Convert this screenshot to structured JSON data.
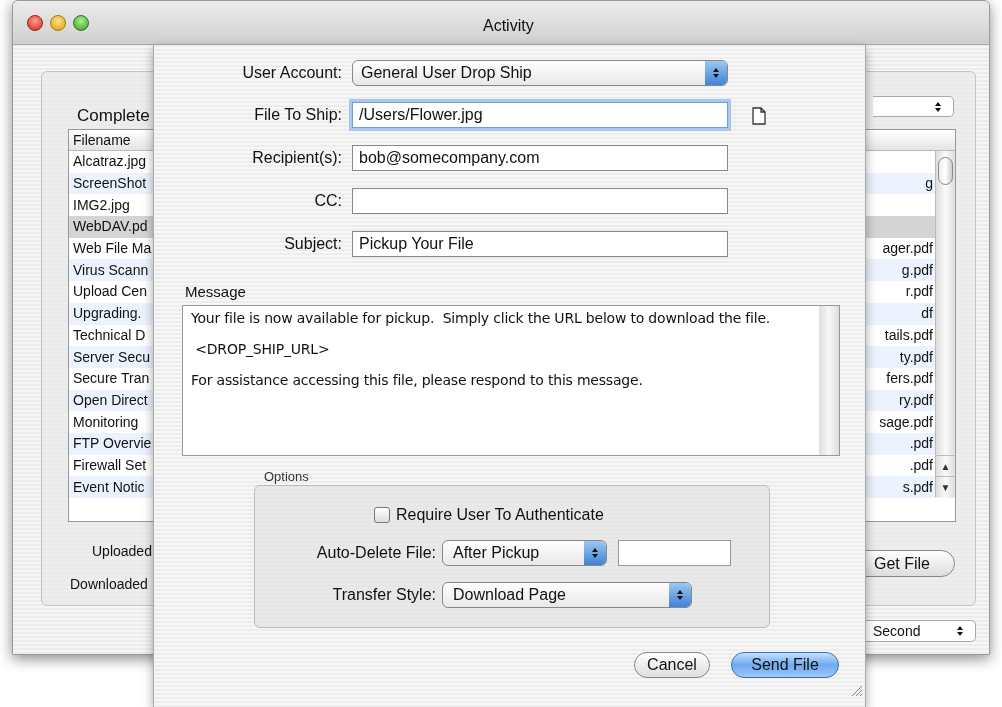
{
  "window": {
    "title": "Activity"
  },
  "completed_files": {
    "title": "Complete",
    "column_1": "Filename",
    "rows": [
      {
        "filename": "Alcatraz.jpg",
        "path_end": "",
        "selected": false
      },
      {
        "filename": "ScreenShot",
        "path_end": "g",
        "selected": false
      },
      {
        "filename": "IMG2.jpg",
        "path_end": "",
        "selected": false
      },
      {
        "filename": "WebDAV.pd",
        "path_end": "",
        "selected": true
      },
      {
        "filename": "Web File Ma",
        "path_end": "ager.pdf",
        "selected": false
      },
      {
        "filename": "Virus Scann",
        "path_end": "g.pdf",
        "selected": false
      },
      {
        "filename": "Upload Cen",
        "path_end": "r.pdf",
        "selected": false
      },
      {
        "filename": "Upgrading.",
        "path_end": "df",
        "selected": false
      },
      {
        "filename": "Technical D",
        "path_end": "tails.pdf",
        "selected": false
      },
      {
        "filename": "Server Secu",
        "path_end": "ty.pdf",
        "selected": false
      },
      {
        "filename": "Secure Tran",
        "path_end": "fers.pdf",
        "selected": false
      },
      {
        "filename": "Open Direct",
        "path_end": "ry.pdf",
        "selected": false
      },
      {
        "filename": "Monitoring",
        "path_end": "sage.pdf",
        "selected": false
      },
      {
        "filename": "FTP Overvie",
        "path_end": ".pdf",
        "selected": false
      },
      {
        "filename": "Firewall Set",
        "path_end": ".pdf",
        "selected": false
      },
      {
        "filename": "Event Notic",
        "path_end": "s.pdf",
        "selected": false
      }
    ],
    "scroll_arrows": [
      "▲",
      "▼"
    ]
  },
  "sound_labels": [
    "Uploaded",
    "Downloaded"
  ],
  "get_file_button": "Get File",
  "refresh_popup": {
    "value": "Second"
  },
  "sheet": {
    "user_account": {
      "label": "User Account:",
      "value": "General User Drop Ship"
    },
    "fields": [
      {
        "label": "File To Ship:",
        "value": "/Users/Flower.jpg",
        "focused": true
      },
      {
        "label": "Recipient(s):",
        "value": "bob@somecompany.com",
        "focused": false
      },
      {
        "label": "CC:",
        "focused": false
      },
      {
        "label": "Subject:",
        "value": "Pickup Your File",
        "focused": false
      }
    ],
    "message": {
      "label": "Message",
      "paragraphs": [
        "Your file is now available for pickup.  Simply click the URL below to download the file.",
        " <DROP_SHIP_URL>",
        "For assistance accessing this file, please respond to this message."
      ]
    },
    "options": {
      "label": "Options",
      "require_auth": {
        "label": "Require User To Authenticate",
        "checked": false
      },
      "auto_delete": {
        "label": "Auto-Delete File:",
        "value": "After Pickup"
      },
      "transfer_style": {
        "label": "Transfer Style:",
        "value": "Download Page"
      }
    },
    "buttons": [
      {
        "label": "Cancel",
        "default": false
      },
      {
        "label": "Send File",
        "default": true
      }
    ]
  }
}
